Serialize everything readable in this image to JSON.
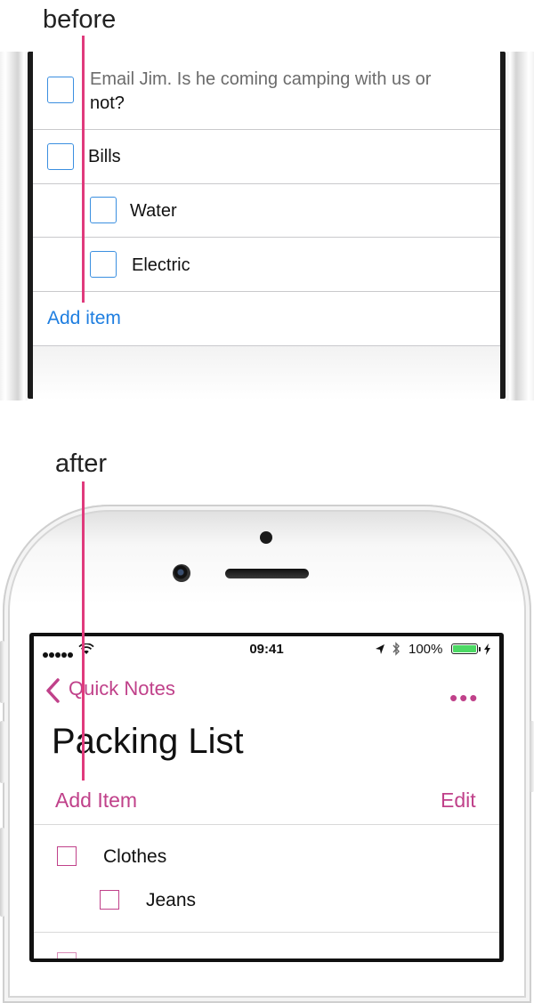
{
  "labels": {
    "before": "before",
    "after": "after"
  },
  "before": {
    "items": [
      {
        "text": "Email Jim. Is he coming camping with us or",
        "text2": "not?"
      },
      {
        "text": "Bills"
      },
      {
        "text": "Water"
      },
      {
        "text": "Electric"
      }
    ],
    "add_item": "Add item",
    "colors": {
      "checkbox": "#3b8fe0",
      "link": "#1e7ee0"
    }
  },
  "after": {
    "status": {
      "time": "09:41",
      "battery": "100%",
      "battery_fill": 1.0
    },
    "nav": {
      "back_label": "Quick Notes",
      "more_icon": "ellipsis-icon"
    },
    "title": "Packing List",
    "add_item": "Add Item",
    "edit": "Edit",
    "items": [
      {
        "text": "Clothes"
      },
      {
        "text": "Jeans"
      }
    ],
    "colors": {
      "accent": "#c0418a",
      "battery": "#4cd964"
    }
  },
  "guide_color": "#e03a7c"
}
